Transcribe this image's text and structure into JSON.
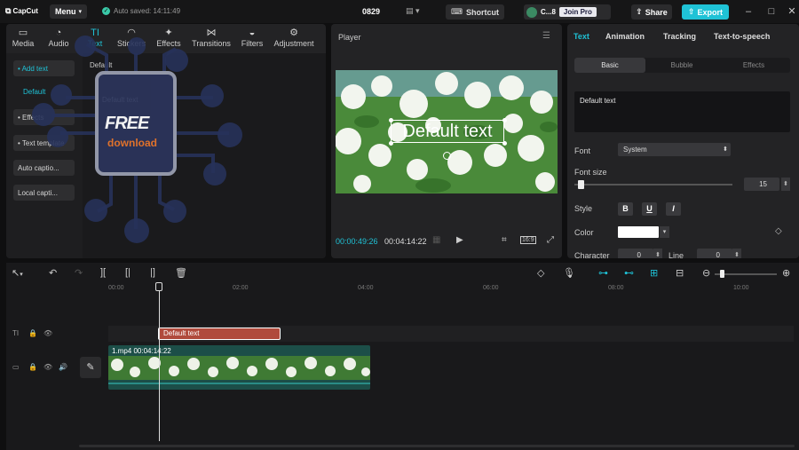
{
  "titlebar": {
    "logo": "CapCut",
    "menu": "Menu",
    "autosave": "Auto saved: 14:11:49",
    "project": "0829",
    "shortcut": "Shortcut",
    "account": "C...8",
    "join_pro": "Join Pro",
    "share": "Share",
    "export": "Export"
  },
  "left_panel": {
    "tabs": [
      {
        "label": "Media",
        "icon": "▭"
      },
      {
        "label": "Audio",
        "icon": "◔"
      },
      {
        "label": "Text",
        "icon": "TI"
      },
      {
        "label": "Stickers",
        "icon": "◠"
      },
      {
        "label": "Effects",
        "icon": "✦"
      },
      {
        "label": "Transitions",
        "icon": "⋈"
      },
      {
        "label": "Filters",
        "icon": "◒"
      },
      {
        "label": "Adjustment",
        "icon": "⚙"
      }
    ],
    "nav": {
      "add_text": "• Add text",
      "default": "Default",
      "effects": "• Effects",
      "text_template": "• Text template",
      "auto_caption": "Auto captio...",
      "local_caption": "Local capti..."
    },
    "section_title": "Default",
    "thumb_text": "Default text",
    "watermark": {
      "line1": "FREE",
      "line2": "download"
    }
  },
  "player": {
    "title": "Player",
    "overlay_text": "Default text",
    "current_time": "00:00:49:26",
    "total_time": "00:04:14:22",
    "ratio": "16:9"
  },
  "right_panel": {
    "tabs": [
      "Text",
      "Animation",
      "Tracking",
      "Text-to-speech"
    ],
    "subtabs": [
      "Basic",
      "Bubble",
      "Effects"
    ],
    "text_value": "Default text",
    "font_label": "Font",
    "font_value": "System",
    "fontsize_label": "Font size",
    "fontsize_value": "15",
    "style_label": "Style",
    "style_buttons": [
      "B",
      "U",
      "I"
    ],
    "color_label": "Color",
    "color_value": "#ffffff",
    "character_label": "Character",
    "character_value": "0",
    "line_label": "Line",
    "line_value": "0"
  },
  "timeline": {
    "ticks": [
      "00:00",
      "02:00",
      "04:00",
      "06:00",
      "08:00",
      "10:00"
    ],
    "text_clip": "Default text",
    "video_clip_label": "1.mp4   00:04:14:22"
  }
}
